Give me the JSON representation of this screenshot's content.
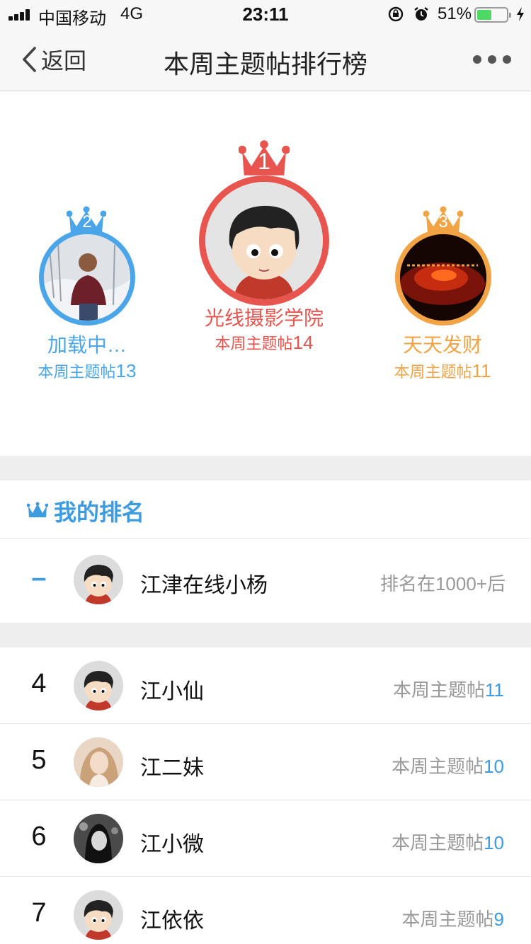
{
  "status_bar": {
    "carrier": "中国移动",
    "network": "4G",
    "time": "23:11",
    "battery_percent": "51%",
    "battery_level": 0.51
  },
  "nav": {
    "back_label": "返回",
    "title": "本周主题帖排行榜"
  },
  "podium": {
    "first": {
      "rank": "1",
      "name": "光线摄影学院",
      "count_label": "本周主题帖",
      "count": "14",
      "color": "#e8554e"
    },
    "second": {
      "rank": "2",
      "name": "加载中…",
      "count_label": "本周主题帖",
      "count": "13",
      "color": "#4aa6e8"
    },
    "third": {
      "rank": "3",
      "name": "天天发财",
      "count_label": "本周主题帖",
      "count": "11",
      "color": "#f2a444"
    }
  },
  "my_ranking": {
    "title": "我的排名",
    "rank": "–",
    "name": "江津在线小杨",
    "status": "排名在1000+后"
  },
  "list": [
    {
      "rank": "4",
      "name": "江小仙",
      "count_label": "本周主题帖",
      "count": "11"
    },
    {
      "rank": "5",
      "name": "江二妹",
      "count_label": "本周主题帖",
      "count": "10"
    },
    {
      "rank": "6",
      "name": "江小微",
      "count_label": "本周主题帖",
      "count": "10"
    },
    {
      "rank": "7",
      "name": "江依依",
      "count_label": "本周主题帖",
      "count": "9"
    }
  ]
}
